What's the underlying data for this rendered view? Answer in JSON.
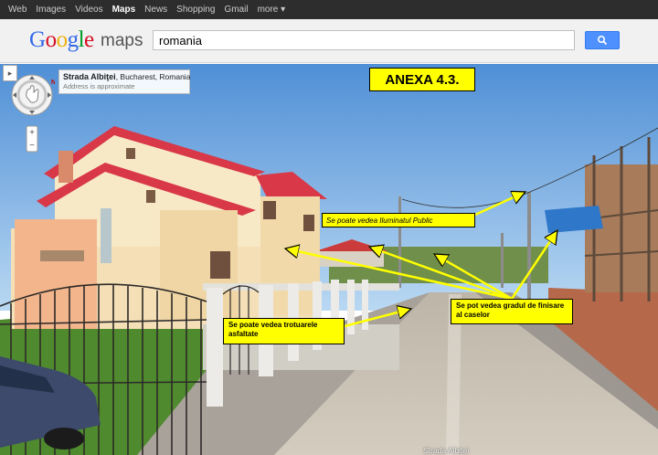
{
  "nav": {
    "items": [
      {
        "label": "Web"
      },
      {
        "label": "Images"
      },
      {
        "label": "Videos"
      },
      {
        "label": "Maps"
      },
      {
        "label": "News"
      },
      {
        "label": "Shopping"
      },
      {
        "label": "Gmail"
      },
      {
        "label": "more ▾"
      }
    ]
  },
  "logo": {
    "g1": "G",
    "o1": "o",
    "o2": "o",
    "g2": "g",
    "l": "l",
    "e": "e",
    "product": "maps"
  },
  "search": {
    "value": "romania",
    "button_icon": "search-icon"
  },
  "address_card": {
    "street": "Strada Albiţei",
    "city": ", Bucharest, Romania",
    "note": "Address is approximate"
  },
  "annex": {
    "label": "ANEXA 4.3."
  },
  "callouts": {
    "lighting": "Se poate vedea  Iluminatul Public",
    "finish": "Se pot vedea  gradul de finisare al caselor",
    "sidewalks": "Se poate vedea trotuarele asfaltate"
  },
  "street_label": "Strada Albiţei",
  "controls": {
    "zoom_in": "+",
    "zoom_out": "−",
    "toggle": "▸"
  },
  "colors": {
    "callout_bg": "#ffff00",
    "nav_bg": "#2d2d2d",
    "search_btn": "#4d90fe"
  }
}
